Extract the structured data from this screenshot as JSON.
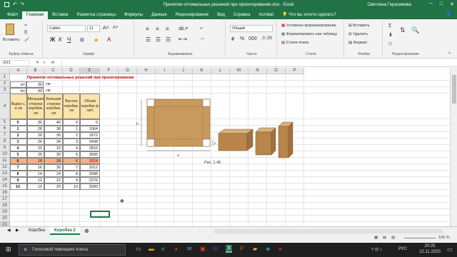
{
  "window": {
    "title": "Принятие оптимальных решений при проектировании.xlsx  -  Excel",
    "user": "Светлана Герасимова"
  },
  "tabs": [
    "Файл",
    "Главная",
    "Вставка",
    "Разметка страницы",
    "Формулы",
    "Данные",
    "Рецензирование",
    "Вид",
    "Справка",
    "Acrobat"
  ],
  "tell_me": "Что вы хотите сделать?",
  "ribbon": {
    "paste": "Вставить",
    "clipboard": "Буфер обмена",
    "font_name": "Calibri",
    "font_size": "11",
    "bold": "Ж",
    "italic": "К",
    "underline": "Ч",
    "font_group": "Шрифт",
    "align_group": "Выравнивание",
    "number_format": "Общий",
    "number_group": "Число",
    "cond_format": "Условное форматирование",
    "format_table": "Форматировать как таблицу",
    "cell_styles": "Стили ячеек",
    "styles_group": "Стили",
    "insert": "Вставить",
    "delete": "Удалить",
    "format": "Формат",
    "cells_group": "Ячейки",
    "edit_group": "Редактирование"
  },
  "formula_bar": {
    "cell_ref": "E21",
    "fx": "fx"
  },
  "columns": [
    "A",
    "B",
    "C",
    "D",
    "E",
    "F",
    "G",
    "H",
    "I",
    "J",
    "K",
    "L",
    "M",
    "N",
    "O",
    "P"
  ],
  "rows": [
    "1",
    "2",
    "3",
    "4",
    "5",
    "6",
    "7",
    "8",
    "9",
    "10",
    "11",
    "12",
    "13",
    "14",
    "15",
    "16",
    "17",
    "18",
    "19",
    "20",
    "21",
    "22"
  ],
  "sheet": {
    "title": "Принятие оптимальных решений при проектировании",
    "a_label": "a=",
    "a_value": "30",
    "a_unit": "см",
    "b_label": "b=",
    "b_value": "40",
    "b_unit": "см",
    "headers": [
      "Вырез с, в см",
      "Меньшая сторона коробки, см",
      "Большая сторона коробки, см",
      "Высота коробки, см",
      "Объем коробки (в см³)"
    ],
    "data": [
      [
        "0",
        "30",
        "40",
        "0",
        "0"
      ],
      [
        "1",
        "28",
        "38",
        "1",
        "1064"
      ],
      [
        "2",
        "26",
        "36",
        "2",
        "1872"
      ],
      [
        "3",
        "24",
        "34",
        "3",
        "2448"
      ],
      [
        "4",
        "22",
        "32",
        "4",
        "2816"
      ],
      [
        "5",
        "20",
        "30",
        "5",
        "3000"
      ],
      [
        "6",
        "18",
        "28",
        "6",
        "3024"
      ],
      [
        "7",
        "16",
        "26",
        "7",
        "2912"
      ],
      [
        "8",
        "14",
        "24",
        "8",
        "2688"
      ],
      [
        "9",
        "12",
        "22",
        "9",
        "2376"
      ],
      [
        "10",
        "10",
        "20",
        "10",
        "2000"
      ]
    ]
  },
  "figure": {
    "label_a": "a",
    "label_b": "b",
    "label_c": "c",
    "caption": "Рис. 1.45"
  },
  "sheet_tabs": [
    "Коробка",
    "Коробка 2"
  ],
  "status": {
    "zoom": "100 %"
  },
  "taskbar": {
    "search": "Голосовой помощник Алиса",
    "time": "20:25",
    "date": "12.11.2020",
    "lang": "РУС"
  },
  "colors": {
    "excel_green": "#217346",
    "header_fill": "#fce4a8",
    "highlight_fill": "#f4b183",
    "title_red": "#c00000",
    "cardboard": "#c89a5e"
  }
}
